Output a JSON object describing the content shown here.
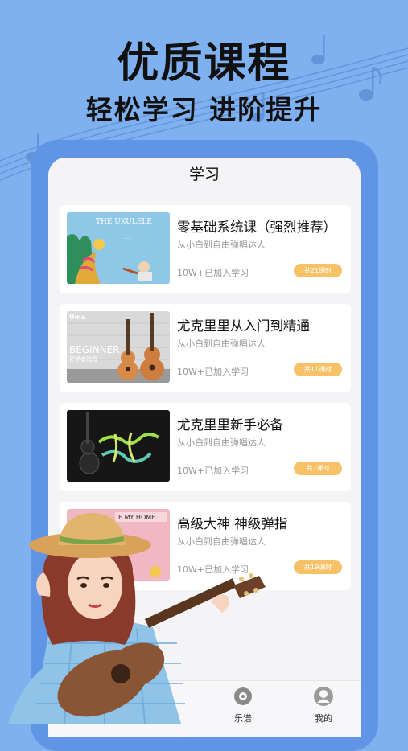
{
  "headline": "优质课程",
  "subline": "轻松学习 进阶提升",
  "screen": {
    "title": "学习"
  },
  "courses": [
    {
      "title": "零基础系统课（强烈推荐）",
      "subtitle": "从小白到自由弹唱达人",
      "learners": "10W+已加入学习",
      "lessons": "共21课时",
      "thumb_text": "THE UKULELE"
    },
    {
      "title": "尤克里里从入门到精通",
      "subtitle": "从小白到自由弹唱达人",
      "learners": "10W+已加入学习",
      "lessons": "共11课时",
      "thumb_text": "BEGINNER",
      "thumb_text2": "初学者福音",
      "thumb_logo": "Uma"
    },
    {
      "title": "尤克里里新手必备",
      "subtitle": "从小白到自由弹唱达人",
      "learners": "10W+已加入学习",
      "lessons": "共7课时"
    },
    {
      "title": "高级大神 神级弹指",
      "subtitle": "从小白到自由弹唱达人",
      "learners": "10W+已加入学习",
      "lessons": "共19课时",
      "thumb_text": "E MY HOME"
    }
  ],
  "tabs": [
    {
      "label": "乐谱",
      "icon": "music-disc-icon"
    },
    {
      "label": "我的",
      "icon": "profile-icon"
    }
  ],
  "colors": {
    "background": "#7fb0ef",
    "phone_frame": "#5f95e4",
    "badge": "#f6c167"
  }
}
